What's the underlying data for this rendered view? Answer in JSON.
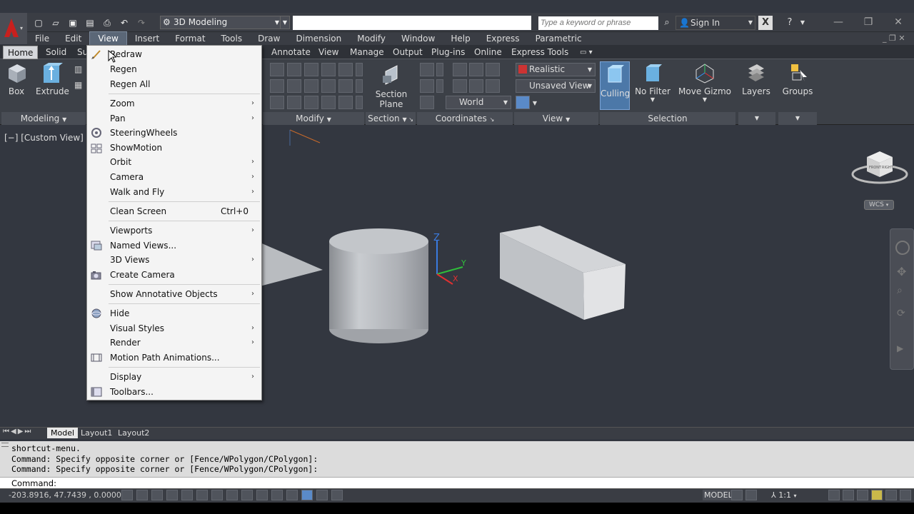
{
  "titlebar": {
    "workspace": "3D Modeling",
    "search_placeholder": "Type a keyword or phrase",
    "sign_in": "Sign In"
  },
  "menubar": [
    "File",
    "Edit",
    "View",
    "Insert",
    "Format",
    "Tools",
    "Draw",
    "Dimension",
    "Modify",
    "Window",
    "Help",
    "Express",
    "Parametric"
  ],
  "ribbon_tabs": {
    "home": "Home",
    "solid": "Solid",
    "surface": "Su",
    "annotate": "Annotate",
    "view": "View",
    "manage": "Manage",
    "output": "Output",
    "plugins": "Plug-ins",
    "online": "Online",
    "express_tools": "Express Tools"
  },
  "ribbon": {
    "box": "Box",
    "extrude": "Extrude",
    "modeling_panel": "Modeling",
    "modify_panel": "Modify",
    "section_plane_1": "Section",
    "section_plane_2": "Plane",
    "section_panel": "Section",
    "coordinates_panel": "Coordinates",
    "world": "World",
    "visual_style": "Realistic",
    "named_view": "Unsaved View",
    "view_panel": "View",
    "culling": "Culling",
    "no_filter": "No Filter",
    "move_gizmo": "Move Gizmo",
    "selection_panel": "Selection",
    "layers": "Layers",
    "groups": "Groups"
  },
  "viewport": {
    "label": "[−] [Custom View] [Rea",
    "wcs": "WCS",
    "axis_z": "Z",
    "axis_y": "Y"
  },
  "view_menu": {
    "redraw": "Redraw",
    "regen": "Regen",
    "regen_all": "Regen All",
    "zoom": "Zoom",
    "pan": "Pan",
    "steering_wheels": "SteeringWheels",
    "show_motion": "ShowMotion",
    "orbit": "Orbit",
    "camera": "Camera",
    "walk_and_fly": "Walk and Fly",
    "clean_screen": "Clean Screen",
    "clean_screen_shortcut": "Ctrl+0",
    "viewports": "Viewports",
    "named_views": "Named Views...",
    "views_3d": "3D Views",
    "create_camera": "Create Camera",
    "show_annotative": "Show Annotative Objects",
    "hide": "Hide",
    "visual_styles": "Visual Styles",
    "render": "Render",
    "motion_path": "Motion Path Animations...",
    "display": "Display",
    "toolbars": "Toolbars..."
  },
  "layout_tabs": {
    "model": "Model",
    "layout1": "Layout1",
    "layout2": "Layout2"
  },
  "command": {
    "history": [
      "shortcut-menu.",
      "Command: Specify opposite corner or [Fence/WPolygon/CPolygon]:",
      "Command: Specify opposite corner or [Fence/WPolygon/CPolygon]:"
    ],
    "prompt": "Command:"
  },
  "status": {
    "coordinates": "-203.8916, 47.7439 , 0.0000",
    "model": "MODEL",
    "scale": "1:1"
  }
}
